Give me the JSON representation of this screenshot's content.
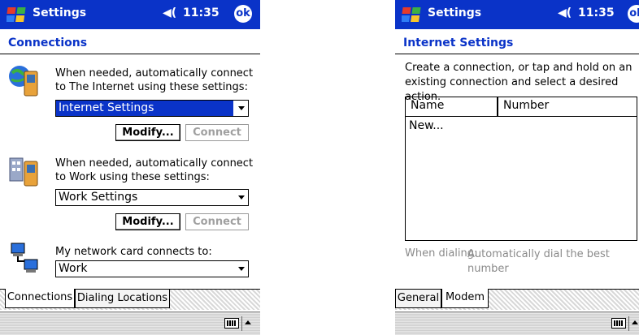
{
  "left_screen": {
    "titlebar": {
      "app_title": "Settings",
      "volume_glyph": "◀(",
      "time": "11:35",
      "ok_label": "ok"
    },
    "page_title": "Connections",
    "internet": {
      "description": "When needed, automatically connect to The Internet using these settings:",
      "selected": "Internet Settings",
      "modify_label": "Modify...",
      "connect_label": "Connect"
    },
    "work": {
      "description": "When needed, automatically connect to Work using these settings:",
      "selected": "Work Settings",
      "modify_label": "Modify...",
      "connect_label": "Connect"
    },
    "network": {
      "description": "My network card connects to:",
      "selected": "Work"
    },
    "tabs": [
      "Connections",
      "Dialing Locations"
    ],
    "active_tab": "Connections"
  },
  "right_screen": {
    "titlebar": {
      "app_title": "Settings",
      "volume_glyph": "◀(",
      "time": "11:35",
      "ok_label": "ok"
    },
    "page_title": "Internet Settings",
    "instructions": "Create a connection, or tap and hold on an existing connection and select a desired action.",
    "list": {
      "columns": [
        "Name",
        "Number"
      ],
      "rows": [
        "New..."
      ]
    },
    "dialing": {
      "label": "When dialing:",
      "value": "Automatically dial the best number"
    },
    "tabs": [
      "General",
      "Modem"
    ],
    "active_tab": "Modem"
  },
  "colors": {
    "titlebar": "#0a33c8",
    "accent": "#0a33c8",
    "disabled_text": "#a0a0a0"
  },
  "icons": [
    "windows-start-icon",
    "volume-icon",
    "globe-phone-icon",
    "building-phone-icon",
    "network-computers-icon",
    "keyboard-icon",
    "sip-up-arrow-icon"
  ]
}
